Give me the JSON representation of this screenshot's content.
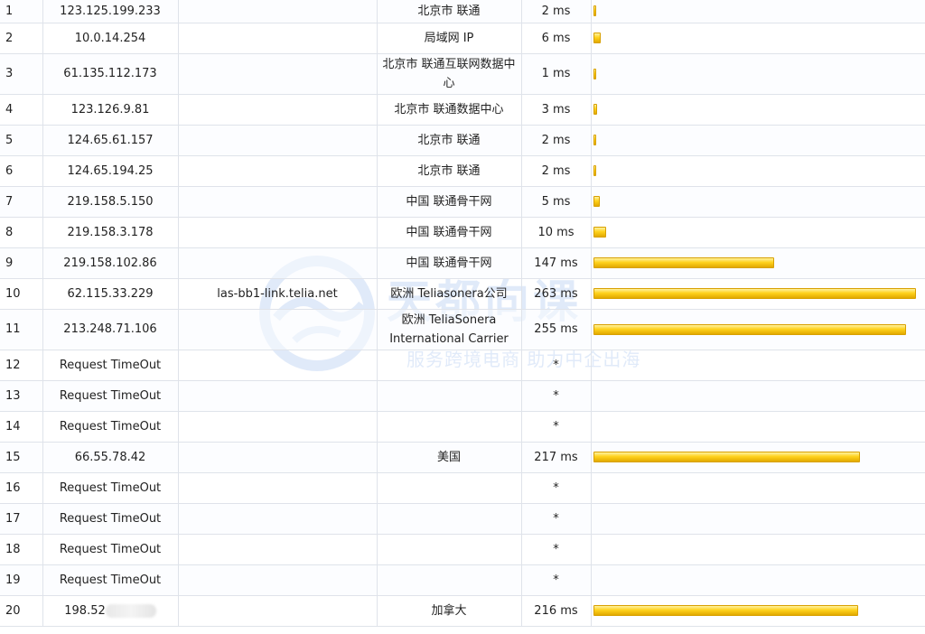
{
  "watermark": {
    "title": "天都向课",
    "subtitle": "服务跨境电商 助力中企出海",
    "logo_icon": "globe-logo-icon"
  },
  "bar_color": "#ffd21c",
  "hops": [
    {
      "hop": "1",
      "ip": "123.125.199.233",
      "host": "",
      "location": "北京市 联通",
      "time": "2 ms",
      "ms": 2
    },
    {
      "hop": "2",
      "ip": "10.0.14.254",
      "host": "",
      "location": "局域网 IP",
      "time": "6 ms",
      "ms": 6
    },
    {
      "hop": "3",
      "ip": "61.135.112.173",
      "host": "",
      "location": "北京市 联通互联网数据中心",
      "time": "1 ms",
      "ms": 1
    },
    {
      "hop": "4",
      "ip": "123.126.9.81",
      "host": "",
      "location": "北京市 联通数据中心",
      "time": "3 ms",
      "ms": 3
    },
    {
      "hop": "5",
      "ip": "124.65.61.157",
      "host": "",
      "location": "北京市 联通",
      "time": "2 ms",
      "ms": 2
    },
    {
      "hop": "6",
      "ip": "124.65.194.25",
      "host": "",
      "location": "北京市 联通",
      "time": "2 ms",
      "ms": 2
    },
    {
      "hop": "7",
      "ip": "219.158.5.150",
      "host": "",
      "location": "中国 联通骨干网",
      "time": "5 ms",
      "ms": 5
    },
    {
      "hop": "8",
      "ip": "219.158.3.178",
      "host": "",
      "location": "中国 联通骨干网",
      "time": "10 ms",
      "ms": 10
    },
    {
      "hop": "9",
      "ip": "219.158.102.86",
      "host": "",
      "location": "中国 联通骨干网",
      "time": "147 ms",
      "ms": 147
    },
    {
      "hop": "10",
      "ip": "62.115.33.229",
      "host": "las-bb1-link.telia.net",
      "location": "欧洲 Teliasonera公司",
      "time": "263 ms",
      "ms": 263
    },
    {
      "hop": "11",
      "ip": "213.248.71.106",
      "host": "",
      "location": "欧洲 TeliaSonera International Carrier",
      "time": "255 ms",
      "ms": 255
    },
    {
      "hop": "12",
      "ip": "Request TimeOut",
      "host": "",
      "location": "",
      "time": "*",
      "ms": 0
    },
    {
      "hop": "13",
      "ip": "Request TimeOut",
      "host": "",
      "location": "",
      "time": "*",
      "ms": 0
    },
    {
      "hop": "14",
      "ip": "Request TimeOut",
      "host": "",
      "location": "",
      "time": "*",
      "ms": 0
    },
    {
      "hop": "15",
      "ip": "66.55.78.42",
      "host": "",
      "location": "美国",
      "time": "217 ms",
      "ms": 217
    },
    {
      "hop": "16",
      "ip": "Request TimeOut",
      "host": "",
      "location": "",
      "time": "*",
      "ms": 0
    },
    {
      "hop": "17",
      "ip": "Request TimeOut",
      "host": "",
      "location": "",
      "time": "*",
      "ms": 0
    },
    {
      "hop": "18",
      "ip": "Request TimeOut",
      "host": "",
      "location": "",
      "time": "*",
      "ms": 0
    },
    {
      "hop": "19",
      "ip": "Request TimeOut",
      "host": "",
      "location": "",
      "time": "*",
      "ms": 0
    },
    {
      "hop": "20",
      "ip": "198.52",
      "host": "",
      "location": "加拿大",
      "time": "216 ms",
      "ms": 216,
      "ip_redacted": true
    }
  ]
}
